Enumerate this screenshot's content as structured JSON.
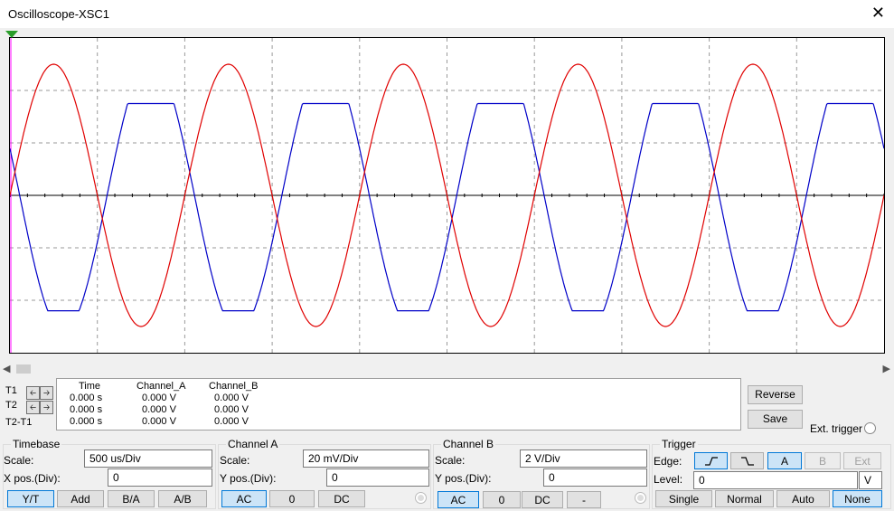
{
  "window": {
    "title": "Oscilloscope-XSC1",
    "close_glyph": "✕"
  },
  "readout": {
    "headers": {
      "time": "Time",
      "channel_a": "Channel_A",
      "channel_b": "Channel_B"
    },
    "rows": [
      {
        "label": "T1",
        "time": "0.000 s",
        "a": "0.000 V",
        "b": "0.000 V"
      },
      {
        "label": "T2",
        "time": "0.000 s",
        "a": "0.000 V",
        "b": "0.000 V"
      },
      {
        "label": "T2-T1",
        "time": "0.000 s",
        "a": "0.000 V",
        "b": "0.000 V"
      }
    ]
  },
  "buttons": {
    "reverse": "Reverse",
    "save": "Save",
    "ext_trigger": "Ext. trigger"
  },
  "timebase": {
    "caption": "Timebase",
    "scale_label": "Scale:",
    "scale": "500 us/Div",
    "xpos_label": "X pos.(Div):",
    "xpos": "0",
    "modes": [
      "Y/T",
      "Add",
      "B/A",
      "A/B"
    ],
    "selected_mode": "Y/T"
  },
  "channel_a": {
    "caption": "Channel A",
    "scale_label": "Scale:",
    "scale": "20 mV/Div",
    "ypos_label": "Y pos.(Div):",
    "ypos": "0",
    "coupling": [
      "AC",
      "0",
      "DC"
    ],
    "selected": "AC"
  },
  "channel_b": {
    "caption": "Channel B",
    "scale_label": "Scale:",
    "scale": "2  V/Div",
    "ypos_label": "Y pos.(Div):",
    "ypos": "0",
    "coupling": [
      "AC",
      "0",
      "DC",
      "-"
    ],
    "selected": "AC"
  },
  "trigger": {
    "caption": "Trigger",
    "edge_label": "Edge:",
    "level_label": "Level:",
    "level": "0",
    "level_unit": "V",
    "sources": [
      "A",
      "B",
      "Ext"
    ],
    "selected_source": "A",
    "modes": [
      "Single",
      "Normal",
      "Auto",
      "None"
    ],
    "selected_mode": "None"
  },
  "colors": {
    "channel_a": "#0000c8",
    "channel_b": "#e00000",
    "grid": "#9a9a9a",
    "cursor": "#ff00ff"
  },
  "chart_data": {
    "type": "line",
    "xlabel": "",
    "ylabel": "",
    "grid": true,
    "time_per_div_us": 500,
    "divisions_x": 10,
    "divisions_y": 6,
    "series": [
      {
        "name": "Channel_A",
        "color": "#0000c8",
        "volts_per_div": 0.02,
        "waveform": "clipped sinusoid",
        "amplitude_div": 1.75,
        "clip_pos_div": 1.75,
        "clip_neg_div": -2.2,
        "periods": 5
      },
      {
        "name": "Channel_B",
        "color": "#e00000",
        "volts_per_div": 2,
        "waveform": "sinusoid",
        "amplitude_div": 2.5,
        "periods": 5
      }
    ]
  }
}
